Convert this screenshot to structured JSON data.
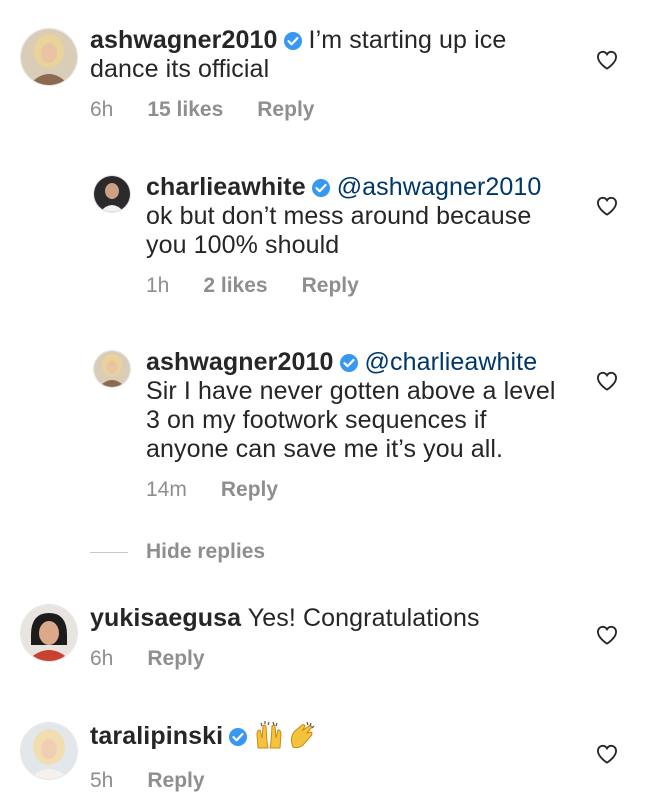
{
  "comments": [
    {
      "username": "ashwagner2010",
      "verified": true,
      "text_lines": [
        "I’m starting up ice",
        "dance its official"
      ],
      "time": "6h",
      "likes": "15 likes",
      "reply": "Reply",
      "replies": [
        {
          "username": "charlieawhite",
          "verified": true,
          "mention": "@ashwagner2010",
          "text_lines": [
            "ok but don’t mess around because",
            "you 100% should"
          ],
          "time": "1h",
          "likes": "2 likes",
          "reply": "Reply"
        },
        {
          "username": "ashwagner2010",
          "verified": true,
          "mention": "@charlieawhite",
          "text_lines": [
            "Sir I have never gotten above a level",
            "3 on my footwork sequences if",
            "anyone can save me it’s you all."
          ],
          "time": "14m",
          "reply": "Reply"
        }
      ],
      "hide_replies": "Hide replies"
    },
    {
      "username": "yukisaegusa",
      "verified": false,
      "text": "Yes! Congratulations",
      "time": "6h",
      "reply": "Reply"
    },
    {
      "username": "taralipinski",
      "verified": true,
      "emojis": [
        "raising-hands-emoji",
        "clapping-hands-emoji"
      ],
      "time": "5h",
      "reply": "Reply"
    }
  ],
  "colors": {
    "text": "#262626",
    "meta": "#8e8e8e",
    "mention": "#00376b",
    "verified": "#3897f0",
    "emoji": "#f5c33b"
  }
}
